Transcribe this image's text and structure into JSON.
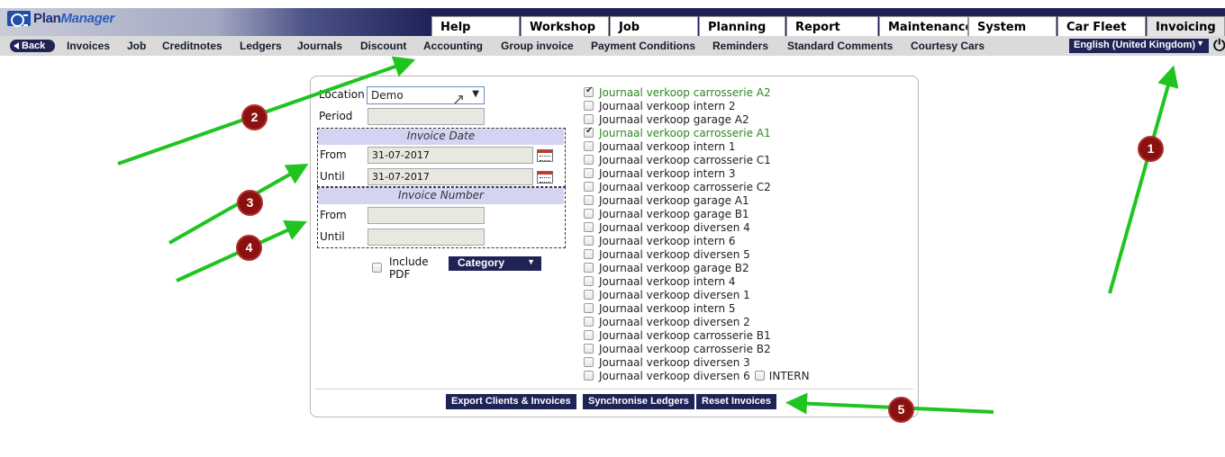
{
  "app": {
    "logo_text_plan": "Plan",
    "logo_text_manager": "Manager"
  },
  "tabs": [
    {
      "label": "Help"
    },
    {
      "label": "Workshop"
    },
    {
      "label": "Job"
    },
    {
      "label": "Planning"
    },
    {
      "label": "Report"
    },
    {
      "label": "Maintenance"
    },
    {
      "label": "System"
    },
    {
      "label": "Car Fleet"
    },
    {
      "label": "Invoicing",
      "active": true
    }
  ],
  "subnav": {
    "back_label": "Back",
    "items": [
      "Invoices",
      "Job",
      "Creditnotes",
      "Ledgers",
      "Journals",
      "Discount",
      "Accounting",
      "Group invoice",
      "Payment Conditions",
      "Reminders",
      "Standard Comments",
      "Courtesy Cars"
    ],
    "language": "English (United Kingdom)"
  },
  "form": {
    "location_label": "Location",
    "location_value": "Demo",
    "period_label": "Period",
    "period_value": "",
    "invoice_date_heading": "Invoice Date",
    "date_from_label": "From",
    "date_from_value": "31-07-2017",
    "date_until_label": "Until",
    "date_until_value": "31-07-2017",
    "invoice_number_heading": "Invoice Number",
    "num_from_label": "From",
    "num_from_value": "",
    "num_until_label": "Until",
    "num_until_value": "",
    "include_label_1": "Include",
    "include_label_2": "PDF",
    "category_label": "Category"
  },
  "journals": [
    {
      "label": "Journaal verkoop carrosserie A2",
      "checked": true
    },
    {
      "label": "Journaal verkoop intern 2",
      "checked": false
    },
    {
      "label": "Journaal verkoop garage A2",
      "checked": false
    },
    {
      "label": "Journaal verkoop carrosserie A1",
      "checked": true
    },
    {
      "label": "Journaal verkoop intern 1",
      "checked": false
    },
    {
      "label": "Journaal verkoop carrosserie C1",
      "checked": false
    },
    {
      "label": "Journaal verkoop intern 3",
      "checked": false
    },
    {
      "label": "Journaal verkoop carrosserie C2",
      "checked": false
    },
    {
      "label": "Journaal verkoop garage A1",
      "checked": false
    },
    {
      "label": "Journaal verkoop garage B1",
      "checked": false
    },
    {
      "label": "Journaal verkoop diversen 4",
      "checked": false
    },
    {
      "label": "Journaal verkoop intern 6",
      "checked": false
    },
    {
      "label": "Journaal verkoop diversen 5",
      "checked": false
    },
    {
      "label": "Journaal verkoop garage B2",
      "checked": false
    },
    {
      "label": "Journaal verkoop intern 4",
      "checked": false
    },
    {
      "label": "Journaal verkoop diversen 1",
      "checked": false
    },
    {
      "label": "Journaal verkoop intern 5",
      "checked": false
    },
    {
      "label": "Journaal verkoop diversen 2",
      "checked": false
    },
    {
      "label": "Journaal verkoop carrosserie B1",
      "checked": false
    },
    {
      "label": "Journaal verkoop carrosserie B2",
      "checked": false
    },
    {
      "label": "Journaal verkoop diversen 3",
      "checked": false
    },
    {
      "label": "Journaal verkoop diversen 6",
      "checked": false
    }
  ],
  "intern_label": "INTERN",
  "actions": {
    "export": "Export Clients & Invoices",
    "sync": "Synchronise Ledgers",
    "reset": "Reset Invoices"
  },
  "annotations": {
    "marker_1": "1",
    "marker_2": "2",
    "marker_3": "3",
    "marker_4": "4",
    "marker_5": "5",
    "arrow_color": "#1fc41f",
    "marker_color": "#8b1010"
  }
}
